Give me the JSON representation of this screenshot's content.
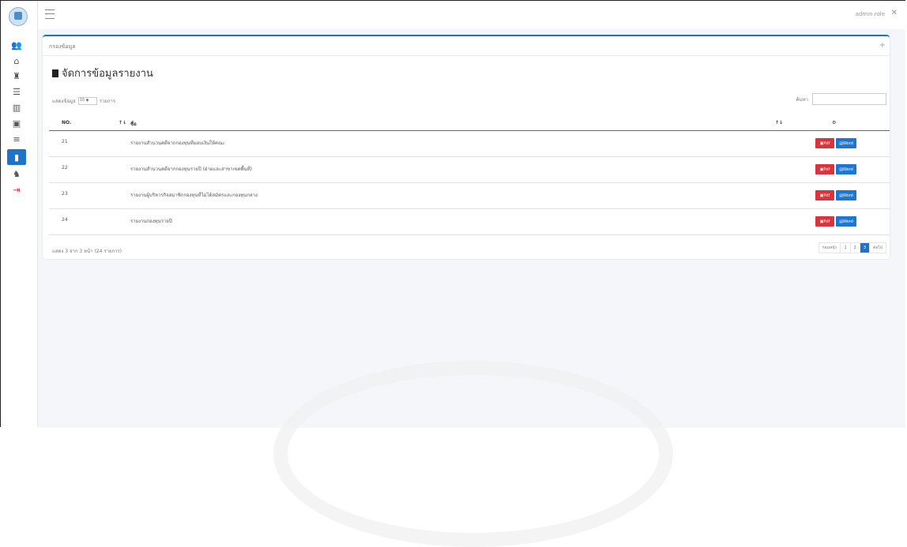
{
  "topbar": {
    "user": "admin role",
    "close": "✕"
  },
  "panel": {
    "title": "กรองข้อมูล",
    "collapse": "+"
  },
  "page": {
    "title": "จัดการข้อมูลรายงาน"
  },
  "table_controls": {
    "show_label": "แสดงข้อมูล",
    "page_size": "10 ◆",
    "records_label": "รายการ",
    "search_label": "ค้นหา"
  },
  "table": {
    "headers": {
      "no": "NO.",
      "name": "ชื่อ",
      "action": "⚙"
    },
    "rows": [
      {
        "no": "21",
        "name": "รายงานสำนวนคดีจากกองทุนที่มอบเงินให้คณะ"
      },
      {
        "no": "22",
        "name": "รายงานสำนวนคดีจากกองทุนรายปี (ฝ่ายและสาขาเขตพื้นที่)"
      },
      {
        "no": "23",
        "name": "รายงานผู้บริหารกิจสมาชิกกองทุนที่ไม่ได้สมัครและกองทุนกลาง"
      },
      {
        "no": "24",
        "name": "รายงานกองทุนรายปี"
      }
    ],
    "buttons": {
      "pdf": "Pdf",
      "word": "Word"
    }
  },
  "footer": {
    "info": "แสดง 3 จาก 3 หน้า (24 รายการ)",
    "pagination": [
      "ก่อนหน้า",
      "1",
      "2",
      "3",
      "ต่อไป"
    ],
    "active_page": "3"
  },
  "icons": [
    "logo-icon",
    "users-icon",
    "home-icon",
    "person-icon",
    "database-icon",
    "building-icon",
    "document-icon",
    "list-icon",
    "report-icon",
    "admin-icon",
    "exit-icon"
  ],
  "colors": {
    "primary": "#1f73c9",
    "danger": "#d7343e"
  }
}
